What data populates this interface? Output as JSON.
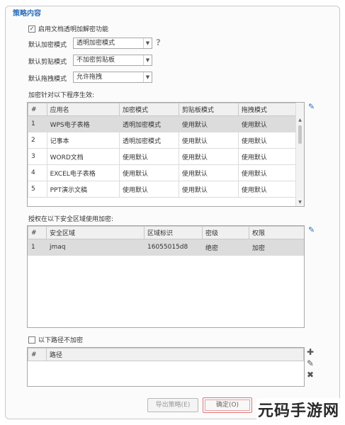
{
  "section_title": "策略内容",
  "enable_checkbox": {
    "label": "启用文档透明加解密功能",
    "checked": true
  },
  "form": {
    "encrypt_mode": {
      "label": "默认加密模式",
      "value": "透明加密模式"
    },
    "clipboard_mode": {
      "label": "默认剪贴模式",
      "value": "不加密剪贴板"
    },
    "drag_mode": {
      "label": "默认拖拽模式",
      "value": "允许拖拽"
    },
    "help_icon": "question-icon"
  },
  "programs": {
    "label": "加密针对以下程序生效:",
    "columns": [
      "#",
      "应用名",
      "加密模式",
      "剪贴板模式",
      "拖拽模式"
    ],
    "rows": [
      [
        "1",
        "WPS电子表格",
        "透明加密模式",
        "使用默认",
        "使用默认"
      ],
      [
        "2",
        "记事本",
        "透明加密模式",
        "使用默认",
        "使用默认"
      ],
      [
        "3",
        "WORD文档",
        "使用默认",
        "使用默认",
        "使用默认"
      ],
      [
        "4",
        "EXCEL电子表格",
        "使用默认",
        "使用默认",
        "使用默认"
      ],
      [
        "5",
        "PPT演示文稿",
        "使用默认",
        "使用默认",
        "使用默认"
      ]
    ]
  },
  "zones": {
    "label": "授权在以下安全区域使用加密:",
    "columns": [
      "#",
      "安全区域",
      "区域标识",
      "密级",
      "权限"
    ],
    "rows": [
      [
        "1",
        "jmaq",
        "16055015d8",
        "绝密",
        "加密"
      ]
    ]
  },
  "exclude": {
    "checkbox_label": "以下路径不加密",
    "checked": false,
    "columns": [
      "#",
      "路径"
    ]
  },
  "buttons": {
    "export": "导出策略(E)",
    "ok": "确定(O)"
  },
  "watermark": "元码手游网"
}
